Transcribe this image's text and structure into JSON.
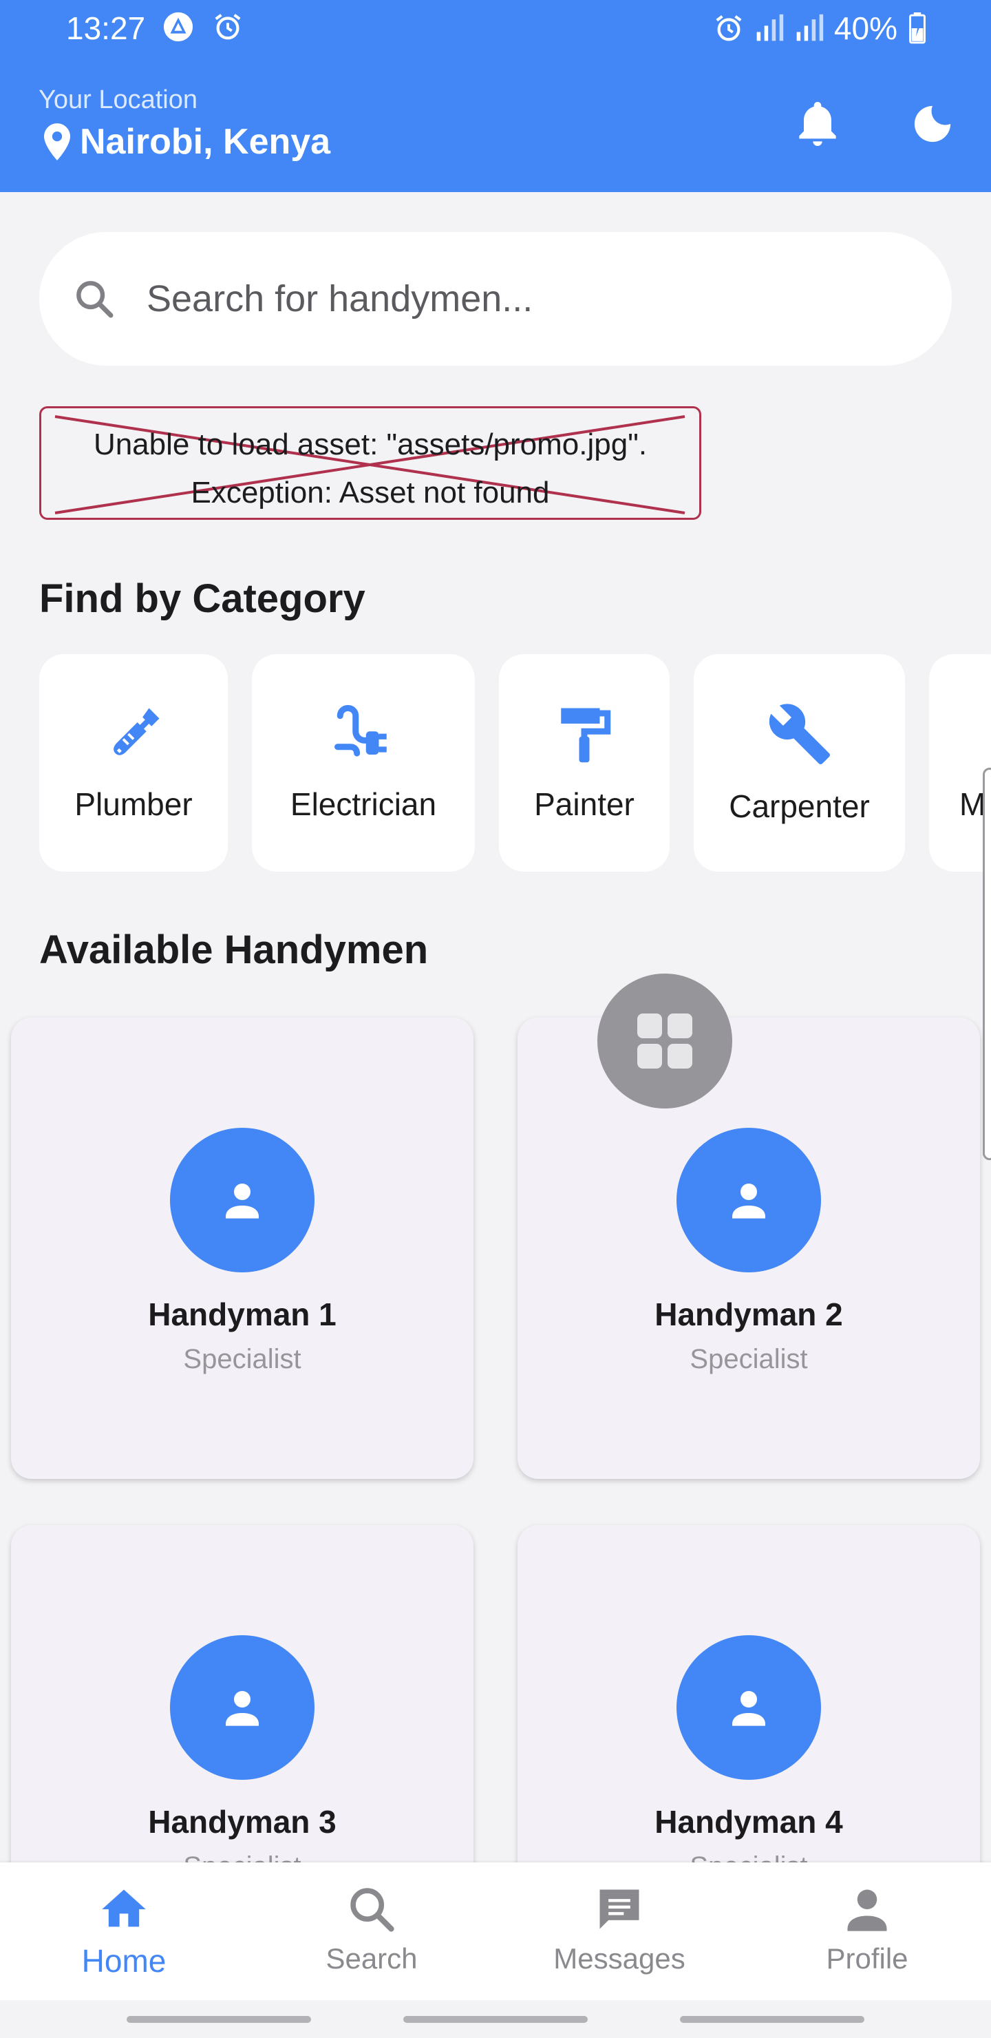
{
  "status_bar": {
    "time": "13:27",
    "battery": "40%"
  },
  "header": {
    "location_label": "Your Location",
    "location": "Nairobi, Kenya"
  },
  "search": {
    "placeholder": "Search for handymen..."
  },
  "error_banner": {
    "line1": "Unable to load asset: \"assets/promo.jpg\".",
    "line2": "Exception: Asset not found"
  },
  "categories": {
    "title": "Find by Category",
    "items": [
      {
        "label": "Plumber",
        "icon": "plumbing-icon"
      },
      {
        "label": "Electrician",
        "icon": "power-plug-icon"
      },
      {
        "label": "Painter",
        "icon": "paint-roller-icon"
      },
      {
        "label": "Carpenter",
        "icon": "wrench-icon"
      },
      {
        "label": "M",
        "icon": ""
      }
    ]
  },
  "handymen": {
    "title": "Available Handymen",
    "items": [
      {
        "name": "Handyman 1",
        "role": "Specialist"
      },
      {
        "name": "Handyman 2",
        "role": "Specialist"
      },
      {
        "name": "Handyman 3",
        "role": "Specialist"
      },
      {
        "name": "Handyman 4",
        "role": "Specialist"
      }
    ]
  },
  "bottom_nav": {
    "items": [
      {
        "label": "Home",
        "icon": "home-icon",
        "active": true
      },
      {
        "label": "Search",
        "icon": "search-icon",
        "active": false
      },
      {
        "label": "Messages",
        "icon": "message-icon",
        "active": false
      },
      {
        "label": "Profile",
        "icon": "person-icon",
        "active": false
      }
    ]
  },
  "colors": {
    "primary": "#4287f5",
    "background": "#f3f3f5",
    "card": "#f4f0f7",
    "error": "#b0314d"
  }
}
